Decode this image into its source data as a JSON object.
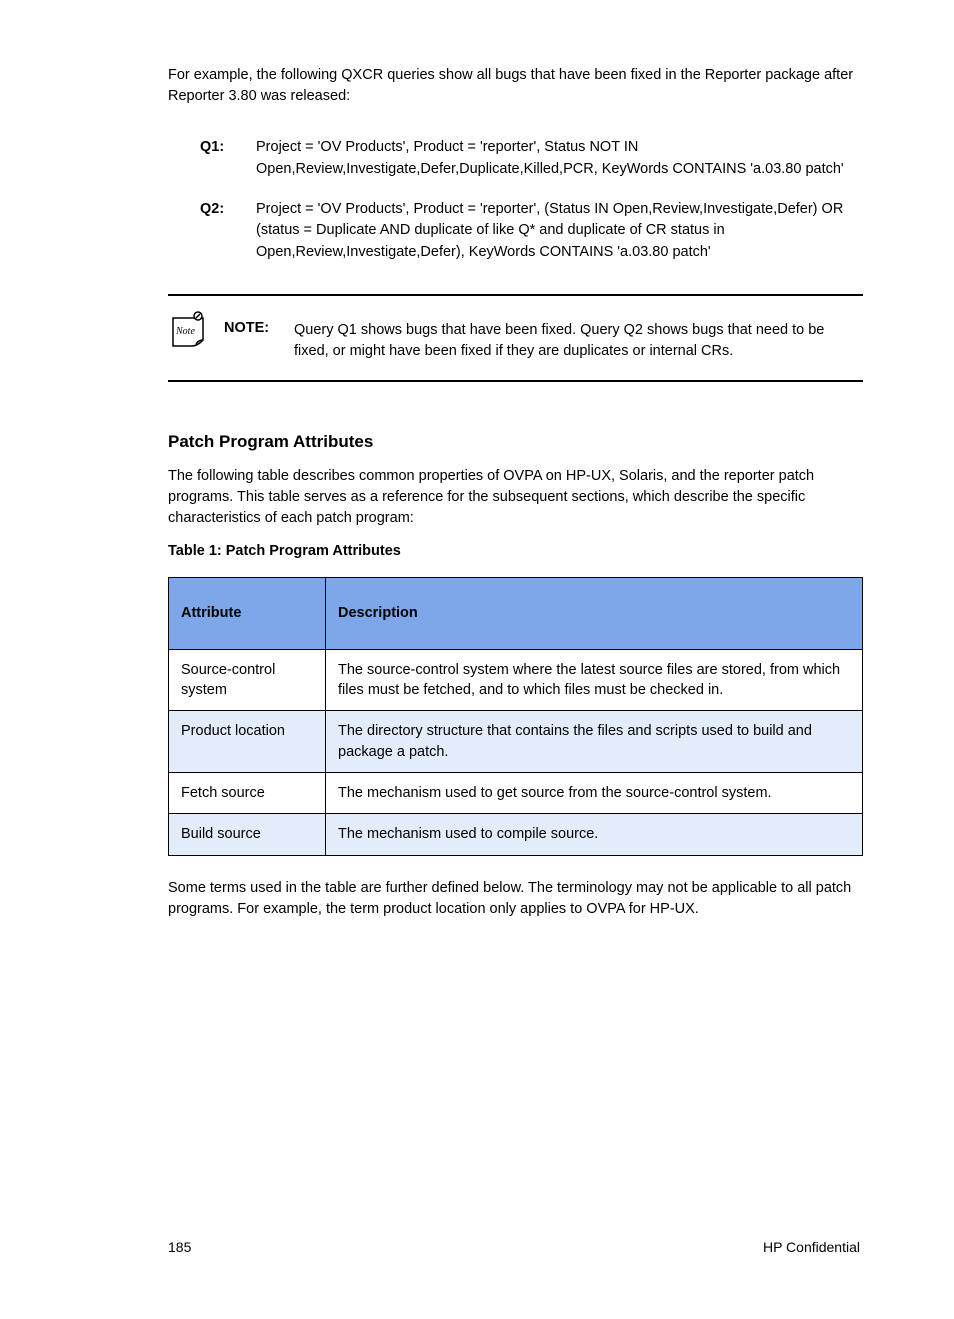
{
  "p1": "For example, the following QXCR queries show all bugs that have been fixed in the Reporter package after Reporter 3.80 was released:",
  "queries": [
    {
      "key": "Q1:",
      "text": "Project = 'OV Products', Product = 'reporter', Status NOT IN Open,Review,Investigate,Defer,Duplicate,Killed,PCR, KeyWords CONTAINS 'a.03.80 patch'"
    },
    {
      "key": "Q2:",
      "text": "Project = 'OV Products', Product = 'reporter', (Status IN Open,Review,Investigate,Defer) OR (status = Duplicate AND duplicate of like Q* and duplicate of CR status in Open,Review,Investigate,Defer), KeyWords CONTAINS 'a.03.80 patch'"
    }
  ],
  "note_label": "NOTE:",
  "note_text": "Query Q1 shows bugs that have been fixed. Query Q2 shows bugs that need to be fixed, or might have been fixed if they are duplicates or internal CRs.",
  "heading": "Patch Program Attributes",
  "p2": "The following table describes common properties of OVPA on HP-UX, Solaris, and the reporter patch programs. This table serves as a reference for the subsequent sections, which describe the specific characteristics of each patch program:",
  "caption": "Table 1: Patch Program Attributes",
  "table": {
    "headers": [
      "Attribute",
      "Description"
    ],
    "rows": [
      {
        "attr": "Source-control system",
        "desc": "The source-control system where the latest source files are stored, from which files must be fetched, and to which files must be checked in."
      },
      {
        "attr": "Product location",
        "desc": "The directory structure that contains the files and scripts used to build and package a patch."
      },
      {
        "attr": "Fetch source",
        "desc": "The mechanism used to get source from the source-control system."
      },
      {
        "attr": "Build source",
        "desc": "The mechanism used to compile source."
      }
    ]
  },
  "p3": "Some terms used in the table are further defined below. The terminology may not be applicable to all patch programs. For example, the term product location only applies to OVPA for HP-UX.",
  "footer_page": "185",
  "footer_right": "HP Confidential"
}
